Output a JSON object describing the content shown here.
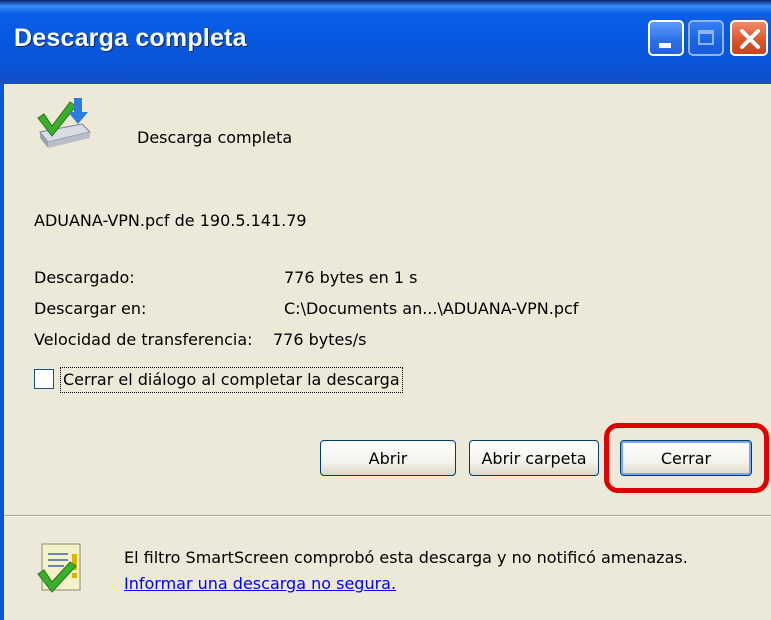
{
  "window": {
    "title": "Descarga completa"
  },
  "header": {
    "message": "Descarga completa"
  },
  "file": {
    "line": "ADUANA-VPN.pcf de 190.5.141.79"
  },
  "details": [
    {
      "label": "Descargado:",
      "value": "776 bytes en 1 s"
    },
    {
      "label": "Descargar en:",
      "value": "C:\\Documents an...\\ADUANA-VPN.pcf"
    },
    {
      "label": "Velocidad de transferencia:",
      "value": "776 bytes/s"
    }
  ],
  "close_on_complete": {
    "label": "Cerrar el diálogo al completar la descarga",
    "checked": false
  },
  "buttons": {
    "open": "Abrir",
    "open_folder": "Abrir carpeta",
    "close": "Cerrar"
  },
  "smartscreen": {
    "message": "El filtro SmartScreen comprobó esta descarga y no notificó amenazas.",
    "report_link": "Informar una descarga no segura."
  },
  "colors": {
    "highlight": "#e00000",
    "titlebar": "#0558e0",
    "link": "#0000ff"
  }
}
